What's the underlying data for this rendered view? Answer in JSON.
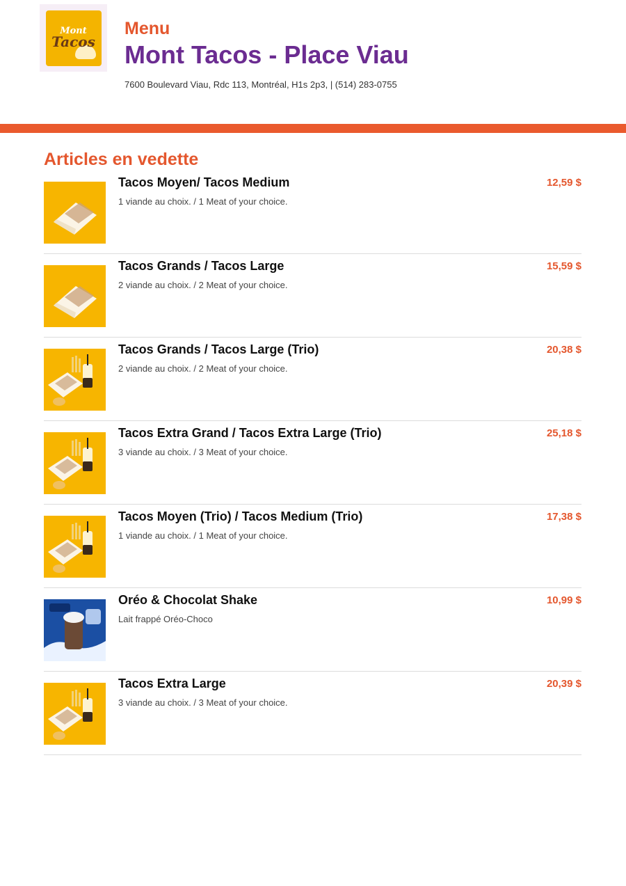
{
  "header": {
    "logo_line1": "Mont",
    "logo_line2": "Tacos",
    "kicker": "Menu",
    "title": "Mont Tacos - Place Viau",
    "address": "7600 Boulevard Viau, Rdc 113, Montréal, H1s 2p3, | (514) 283-0755"
  },
  "colors": {
    "accent": "#e4572e",
    "title": "#6b2c91",
    "bar": "#ea5a2d",
    "thumb_yellow": "#f6b400",
    "thumb_blue": "#1b4fa3"
  },
  "section": {
    "title": "Articles en vedette"
  },
  "items": [
    {
      "name": "Tacos Moyen/ Tacos Medium",
      "desc": "1 viande au choix. / 1 Meat of your choice.",
      "price": "12,59 $",
      "image": "taco-wrap-image"
    },
    {
      "name": "Tacos Grands / Tacos Large",
      "desc": "2 viande au choix. / 2 Meat of your choice.",
      "price": "15,59 $",
      "image": "taco-wrap-image"
    },
    {
      "name": "Tacos Grands / Tacos Large (Trio)",
      "desc": "2 viande au choix. / 2 Meat of your choice.",
      "price": "20,38 $",
      "image": "trio-combo-image"
    },
    {
      "name": "Tacos Extra Grand / Tacos Extra Large (Trio)",
      "desc": "3 viande au choix. / 3 Meat of your choice.",
      "price": "25,18 $",
      "image": "trio-combo-image"
    },
    {
      "name": "Tacos Moyen (Trio) / Tacos Medium (Trio)",
      "desc": "1 viande au choix. / 1 Meat of your choice.",
      "price": "17,38 $",
      "image": "trio-combo-image"
    },
    {
      "name": "Oréo & Chocolat Shake",
      "desc": "Lait frappé Oréo-Choco",
      "price": "10,99 $",
      "image": "shake-image"
    },
    {
      "name": "Tacos Extra Large",
      "desc": "3 viande au choix. / 3 Meat of your choice.",
      "price": "20,39 $",
      "image": "trio-combo-image"
    }
  ]
}
